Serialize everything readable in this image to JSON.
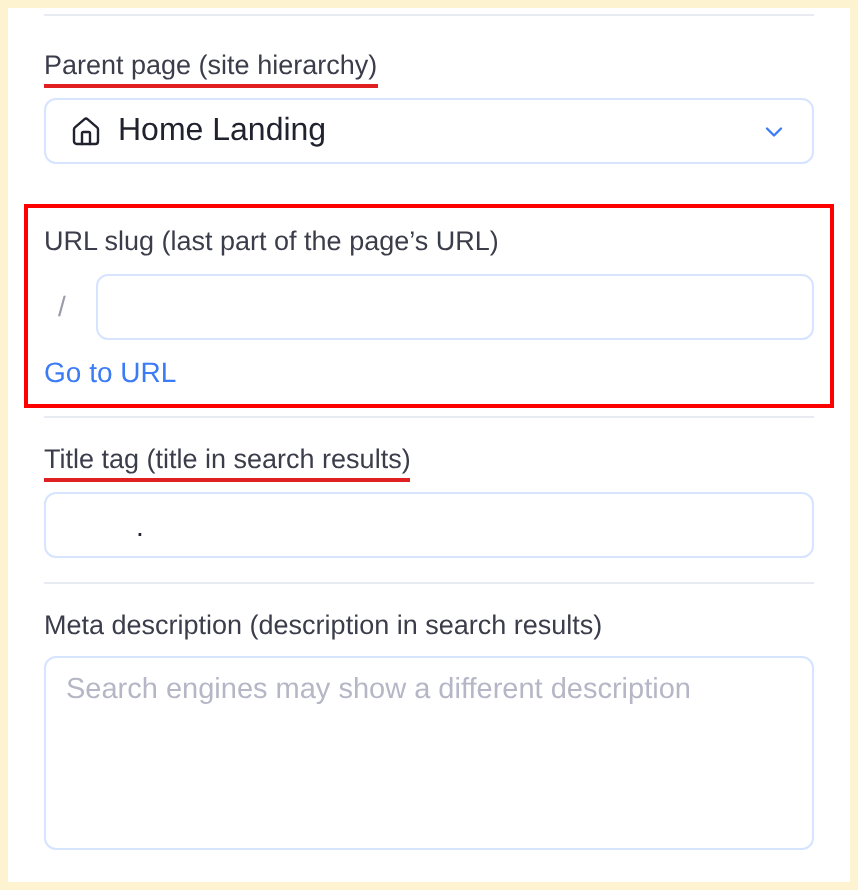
{
  "fields": [
    {
      "kind": "select",
      "label": "Parent page (site hierarchy)",
      "underlined": true,
      "boxed": false,
      "value": "Home Landing"
    },
    {
      "kind": "slug",
      "label": "URL slug (last part of the page’s URL)",
      "underlined": false,
      "boxed": true,
      "prefix": "/",
      "link": "Go to URL"
    },
    {
      "kind": "text",
      "label": "Title tag (title in search results)",
      "underlined": true,
      "boxed": false,
      "value": "."
    },
    {
      "kind": "textarea",
      "label": "Meta description (description in search results)",
      "underlined": false,
      "boxed": false,
      "placeholder": "Search engines may show a different description"
    }
  ]
}
